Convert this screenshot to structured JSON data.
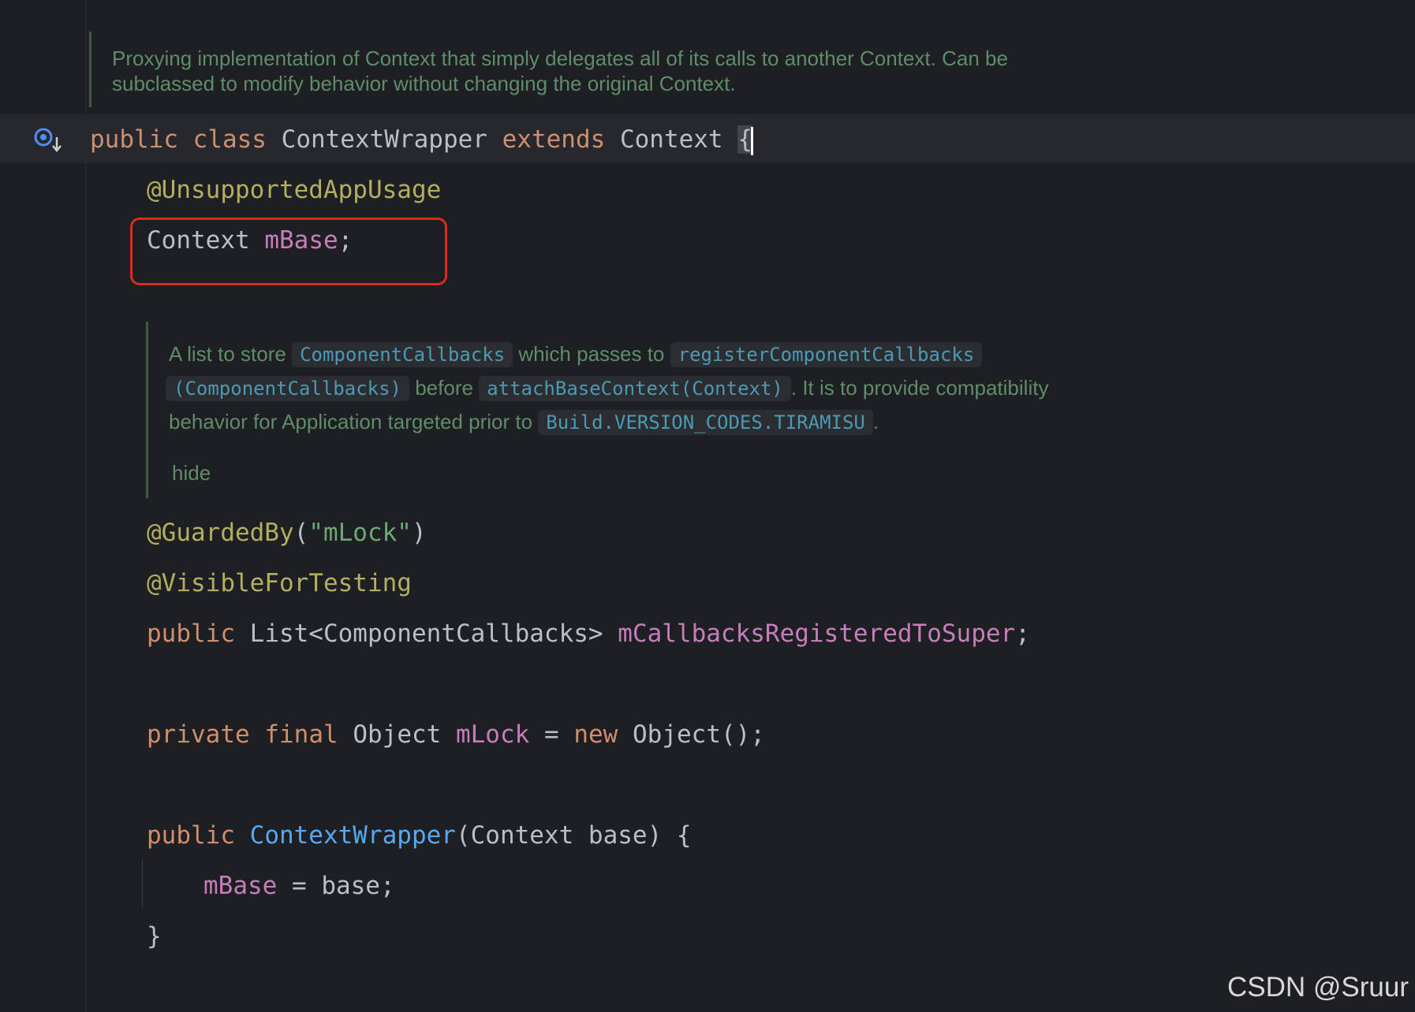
{
  "doc_comment_1": {
    "line1": "Proxying implementation of Context that simply delegates all of its calls to another Context. Can be",
    "line2": "subclassed to modify behavior without changing the original Context."
  },
  "class_decl": {
    "public": "public",
    "class": "class",
    "name": "ContextWrapper",
    "extends": "extends",
    "parent": "Context",
    "brace": "{"
  },
  "field1": {
    "annotation": "@UnsupportedAppUsage",
    "type": "Context",
    "name": "mBase",
    "semicolon": ";"
  },
  "doc_comment_2": {
    "t1": "A list to store",
    "c1": "ComponentCallbacks",
    "t2": "which passes to",
    "c2": "registerComponentCallbacks",
    "c3": "(ComponentCallbacks)",
    "t3": "before",
    "c4": "attachBaseContext(Context)",
    "t4": ". It is to provide compatibility",
    "t5": "behavior for Application targeted prior to",
    "c5": "Build.VERSION_CODES.TIRAMISU",
    "t6": ".",
    "hide": "hide"
  },
  "field2": {
    "annotation1": "@GuardedBy",
    "paren_open": "(",
    "annotation1_arg": "\"mLock\"",
    "paren_close": ")",
    "annotation2": "@VisibleForTesting",
    "public": "public",
    "type": "List<ComponentCallbacks>",
    "name": "mCallbacksRegisteredToSuper",
    "semicolon": ";"
  },
  "field3": {
    "private": "private",
    "final": "final",
    "type": "Object",
    "name": "mLock",
    "eq": "=",
    "new": "new",
    "init": "Object();"
  },
  "constructor": {
    "public": "public",
    "name": "ContextWrapper",
    "params": "(Context base) {",
    "body_field": "mBase",
    "body_rest": " = base;",
    "close": "}"
  },
  "watermark": "CSDN @Sruur",
  "colors": {
    "background": "#1e1f22",
    "keyword": "#cf8e6d",
    "annotation": "#b3ae60",
    "field": "#c77dbb",
    "string": "#6aab73",
    "function": "#56a8f5",
    "doc": "#5f8c6a",
    "highlight_box": "#e0281e"
  }
}
